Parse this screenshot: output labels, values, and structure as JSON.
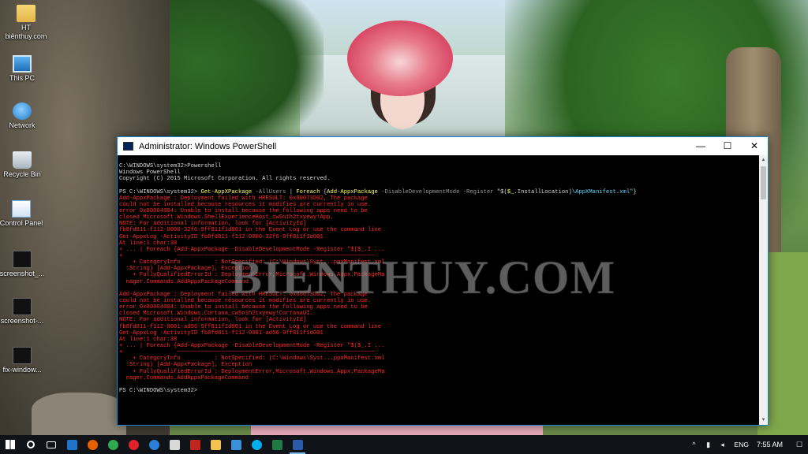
{
  "desktop": {
    "icons": [
      {
        "label": "HT biênthuy.com",
        "icon": "folder-icon"
      },
      {
        "label": "This PC",
        "icon": "computer-icon"
      },
      {
        "label": "Network",
        "icon": "network-icon"
      },
      {
        "label": "Recycle Bin",
        "icon": "recycle-bin-icon"
      },
      {
        "label": "Control Panel",
        "icon": "control-panel-icon"
      },
      {
        "label": "screenshot_...",
        "icon": "image-file-icon"
      },
      {
        "label": "screenshot-...",
        "icon": "image-file-icon"
      },
      {
        "label": "fix-window...",
        "icon": "image-file-icon"
      }
    ]
  },
  "window": {
    "title": "Administrator: Windows PowerShell",
    "minimize": "—",
    "maximize": "☐",
    "close": "✕",
    "console_lines": [
      {
        "segments": [
          {
            "text": "C:\\WINDOWS\\system32>Powershell",
            "color": "white"
          }
        ]
      },
      {
        "segments": [
          {
            "text": "Windows PowerShell",
            "color": "white"
          }
        ]
      },
      {
        "segments": [
          {
            "text": "Copyright (C) 2015 Microsoft Corporation. All rights reserved.",
            "color": "white"
          }
        ]
      },
      {
        "segments": [
          {
            "text": "",
            "color": "white"
          }
        ]
      },
      {
        "segments": [
          {
            "text": "PS C:\\WINDOWS\\system32> ",
            "color": "white"
          },
          {
            "text": "Get-AppXPackage",
            "color": "yellow"
          },
          {
            "text": " -AllUsers ",
            "color": "gray"
          },
          {
            "text": "| ",
            "color": "white"
          },
          {
            "text": "Foreach",
            "color": "yellow"
          },
          {
            "text": " {",
            "color": "white"
          },
          {
            "text": "Add-AppxPackage",
            "color": "yellow"
          },
          {
            "text": " -DisableDevelopmentMode -Register ",
            "color": "gray"
          },
          {
            "text": "\"$(",
            "color": "white"
          },
          {
            "text": "$_",
            "color": "yellow"
          },
          {
            "text": ".InstallLocation)",
            "color": "white"
          },
          {
            "text": "\\AppXManifest.xml\"",
            "color": "cyan"
          },
          {
            "text": "}",
            "color": "white"
          }
        ]
      },
      {
        "segments": [
          {
            "text": "Add-AppxPackage : Deployment failed with HRESULT: 0x80073D02, The package",
            "color": "red"
          }
        ]
      },
      {
        "segments": [
          {
            "text": "could not be installed because resources it modifies are currently in use.",
            "color": "red"
          }
        ]
      },
      {
        "segments": [
          {
            "text": "error 0x80004004: Unable to install because the following apps need to be",
            "color": "red"
          }
        ]
      },
      {
        "segments": [
          {
            "text": "closed Microsoft.Windows.ShellExperienceHost_cw5n1h2txyewy!App.",
            "color": "red"
          }
        ]
      },
      {
        "segments": [
          {
            "text": "NOTE: For additional information, look for [ActivityId]",
            "color": "red"
          }
        ]
      },
      {
        "segments": [
          {
            "text": "fb8fd811-f112-0000-32f6-9ff811f1d001 in the Event Log or use the command line",
            "color": "red"
          }
        ]
      },
      {
        "segments": [
          {
            "text": "Get-AppxLog -ActivityID fb8fd811-f112-0000-32f6-9ff811f1d001",
            "color": "red"
          }
        ]
      },
      {
        "segments": [
          {
            "text": "At line:1 char:38",
            "color": "red"
          }
        ]
      },
      {
        "segments": [
          {
            "text": "+ ... | Foreach {Add-AppxPackage -DisableDevelopmentMode -Register \"$($_.I ...",
            "color": "red"
          }
        ]
      },
      {
        "segments": [
          {
            "text": "+                ~~~~~~~~~~~~~~~~~~~~~~~~~~~~~~~~~~~~~~~~~~~~~~~~~~~~~~~~~~",
            "color": "red"
          }
        ]
      },
      {
        "segments": [
          {
            "text": "    + CategoryInfo          : NotSpecified: (C:\\Windows\\Syst...ppxManifest.xml",
            "color": "red"
          }
        ]
      },
      {
        "segments": [
          {
            "text": "  :String) [Add-AppxPackage], Exception",
            "color": "red"
          }
        ]
      },
      {
        "segments": [
          {
            "text": "    + FullyQualifiedErrorId : DeploymentError,Microsoft.Windows.Appx.PackageMa",
            "color": "red"
          }
        ]
      },
      {
        "segments": [
          {
            "text": "  nager.Commands.AddAppxPackageCommand",
            "color": "red"
          }
        ]
      },
      {
        "segments": [
          {
            "text": "",
            "color": "white"
          }
        ]
      },
      {
        "segments": [
          {
            "text": "Add-AppxPackage : Deployment failed with HRESULT: 0x80073D02, The package",
            "color": "red"
          }
        ]
      },
      {
        "segments": [
          {
            "text": "could not be installed because resources it modifies are currently in use.",
            "color": "red"
          }
        ]
      },
      {
        "segments": [
          {
            "text": "error 0x80004004: Unable to install because the following apps need to be",
            "color": "red"
          }
        ]
      },
      {
        "segments": [
          {
            "text": "closed Microsoft.Windows.Cortana_cw5n1h2txyewy!CortanaUI.",
            "color": "red"
          }
        ]
      },
      {
        "segments": [
          {
            "text": "NOTE: For additional information, look for [ActivityId]",
            "color": "red"
          }
        ]
      },
      {
        "segments": [
          {
            "text": "fb8fd811-f112-0001-ad56-9ff811f1d001 in the Event Log or use the command line",
            "color": "red"
          }
        ]
      },
      {
        "segments": [
          {
            "text": "Get-AppxLog -ActivityID fb8fd811-f112-0001-ad56-9ff811f1d001",
            "color": "red"
          }
        ]
      },
      {
        "segments": [
          {
            "text": "At line:1 char:38",
            "color": "red"
          }
        ]
      },
      {
        "segments": [
          {
            "text": "+ ... | Foreach {Add-AppxPackage -DisableDevelopmentMode -Register \"$($_.I ...",
            "color": "red"
          }
        ]
      },
      {
        "segments": [
          {
            "text": "+                ~~~~~~~~~~~~~~~~~~~~~~~~~~~~~~~~~~~~~~~~~~~~~~~~~~~~~~~~~~",
            "color": "red"
          }
        ]
      },
      {
        "segments": [
          {
            "text": "    + CategoryInfo          : NotSpecified: (C:\\Windows\\Syst...ppxManifest.xml",
            "color": "red"
          }
        ]
      },
      {
        "segments": [
          {
            "text": "  :String) [Add-AppxPackage], Exception",
            "color": "red"
          }
        ]
      },
      {
        "segments": [
          {
            "text": "    + FullyQualifiedErrorId : DeploymentError,Microsoft.Windows.Appx.PackageMa",
            "color": "red"
          }
        ]
      },
      {
        "segments": [
          {
            "text": "  nager.Commands.AddAppxPackageCommand",
            "color": "red"
          }
        ]
      },
      {
        "segments": [
          {
            "text": "",
            "color": "white"
          }
        ]
      },
      {
        "segments": [
          {
            "text": "PS C:\\WINDOWS\\system32>",
            "color": "white"
          }
        ]
      }
    ]
  },
  "watermark": "BIENTHUY.COM",
  "taskbar": {
    "apps": [
      {
        "name": "start-button",
        "icon": "windows-logo-icon",
        "color": "#ffffff",
        "active": false
      },
      {
        "name": "search-button",
        "icon": "search-icon",
        "color": "#ffffff",
        "active": false
      },
      {
        "name": "task-view-button",
        "icon": "task-view-icon",
        "color": "#ffffff",
        "active": false
      },
      {
        "name": "taskbar-app-1",
        "icon": "app-icon",
        "color": "#1e73c8",
        "active": false
      },
      {
        "name": "taskbar-firefox",
        "icon": "firefox-icon",
        "color": "#e66000",
        "active": false
      },
      {
        "name": "taskbar-chrome",
        "icon": "chrome-icon",
        "color": "#2fa84f",
        "active": false
      },
      {
        "name": "taskbar-opera",
        "icon": "opera-icon",
        "color": "#e0202a",
        "active": false
      },
      {
        "name": "taskbar-edge",
        "icon": "edge-icon",
        "color": "#2a7fd4",
        "active": false
      },
      {
        "name": "taskbar-app-2",
        "icon": "app-icon",
        "color": "#d8d8d8",
        "active": false
      },
      {
        "name": "taskbar-filezilla",
        "icon": "filezilla-icon",
        "color": "#c0261d",
        "active": false
      },
      {
        "name": "taskbar-file-explorer",
        "icon": "folder-icon",
        "color": "#f2c14e",
        "active": false
      },
      {
        "name": "taskbar-app-3",
        "icon": "app-icon",
        "color": "#3b8fd9",
        "active": false
      },
      {
        "name": "taskbar-skype",
        "icon": "skype-icon",
        "color": "#00aff0",
        "active": false
      },
      {
        "name": "taskbar-excel",
        "icon": "excel-icon",
        "color": "#1f7a45",
        "active": false
      },
      {
        "name": "taskbar-powershell",
        "icon": "powershell-icon",
        "color": "#2a5aa8",
        "active": true
      }
    ],
    "tray": {
      "chevron": "^",
      "network": "▮",
      "volume": "◂",
      "language": "ENG",
      "time": "7:55 AM",
      "notification": "☐"
    }
  }
}
